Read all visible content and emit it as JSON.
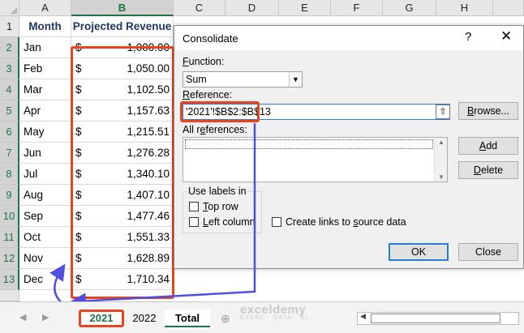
{
  "columns": [
    "A",
    "B",
    "C",
    "D",
    "E",
    "F",
    "G",
    "H"
  ],
  "rows": [
    "1",
    "2",
    "3",
    "4",
    "5",
    "6",
    "7",
    "8",
    "9",
    "10",
    "11",
    "12",
    "13"
  ],
  "header": {
    "month": "Month",
    "revenue": "Projected Revenue"
  },
  "data": [
    {
      "month": "Jan",
      "currency": "$",
      "amount": "1,000.00"
    },
    {
      "month": "Feb",
      "currency": "$",
      "amount": "1,050.00"
    },
    {
      "month": "Mar",
      "currency": "$",
      "amount": "1,102.50"
    },
    {
      "month": "Apr",
      "currency": "$",
      "amount": "1,157.63"
    },
    {
      "month": "May",
      "currency": "$",
      "amount": "1,215.51"
    },
    {
      "month": "Jun",
      "currency": "$",
      "amount": "1,276.28"
    },
    {
      "month": "Jul",
      "currency": "$",
      "amount": "1,340.10"
    },
    {
      "month": "Aug",
      "currency": "$",
      "amount": "1,407.10"
    },
    {
      "month": "Sep",
      "currency": "$",
      "amount": "1,477.46"
    },
    {
      "month": "Oct",
      "currency": "$",
      "amount": "1,551.33"
    },
    {
      "month": "Nov",
      "currency": "$",
      "amount": "1,628.89"
    },
    {
      "month": "Dec",
      "currency": "$",
      "amount": "1,710.34"
    }
  ],
  "dialog": {
    "title": "Consolidate",
    "help": "?",
    "close": "✕",
    "function_label_pre": "",
    "function_label_u": "F",
    "function_label_post": "unction:",
    "function_value": "Sum",
    "dropdown_arrow": "▼",
    "reference_label_pre": "",
    "reference_label_u": "R",
    "reference_label_post": "eference:",
    "reference_value": "'2021'!$B$2:$B$13",
    "collapse_icon": "⇧",
    "browse_pre": "",
    "browse_u": "B",
    "browse_post": "rowse...",
    "all_references_pre": "All r",
    "all_references_u": "e",
    "all_references_post": "ferences:",
    "add_pre": "",
    "add_u": "A",
    "add_post": "dd",
    "delete_pre": "",
    "delete_u": "D",
    "delete_post": "elete",
    "use_labels": "Use labels in",
    "top_row_pre": "",
    "top_row_u": "T",
    "top_row_post": "op row",
    "left_column_pre": "",
    "left_column_u": "L",
    "left_column_post": "eft column",
    "create_links_pre": "Create links to ",
    "create_links_u": "s",
    "create_links_post": "ource data",
    "ok": "OK",
    "close_button": "Close",
    "scroll_up": "▲",
    "scroll_down": "▼"
  },
  "tabs": [
    "2021",
    "2022",
    "Total"
  ],
  "watermark": {
    "name": "exceldemy",
    "tagline": "EXCEL · DATA · BI"
  },
  "nav": {
    "prev": "◀",
    "next": "▶",
    "add": "⊕"
  },
  "colors": {
    "highlight": "#e8441e",
    "arrow": "#4f4ee0",
    "excel_green": "#217346"
  }
}
